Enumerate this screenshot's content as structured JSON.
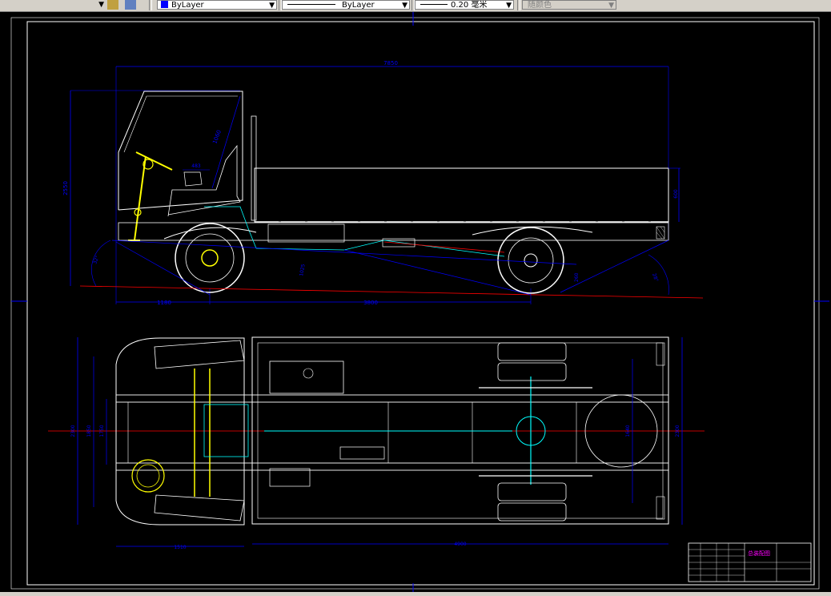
{
  "toolbar": {
    "color_control": "ByLayer",
    "linetype_control": "ByLayer",
    "lineweight_control": "0.20 毫米",
    "plotstyle_control": "随颜色"
  },
  "drawing": {
    "side_view": {
      "overall_length": "7850",
      "overall_height": "2550",
      "front_overhang": "1180",
      "wheelbase": "3800",
      "cab_dim_a": "1060",
      "cab_dim_b": "483",
      "cargo_height": "600",
      "approach_angle": "32°",
      "departure_angle": "28°",
      "ground_clearance": "260",
      "ramp_dim": "1025"
    },
    "plan_view": {
      "overall_width_left": "2300",
      "inner_width_1": "1850",
      "inner_width_2": "1750",
      "overall_width_right": "2300",
      "rear_track": "1640",
      "cab_length": "1510",
      "cargo_length": "4900"
    },
    "title_block": {
      "drawing_name": "总装配图"
    }
  },
  "colors": {
    "background": "#000000",
    "outline": "#ffffff",
    "dimension": "#0000ff",
    "centerline": "#ff0000",
    "hydraulic": "#00ffff",
    "steering": "#ffff00",
    "titleblock_text": "#ff00ff"
  }
}
